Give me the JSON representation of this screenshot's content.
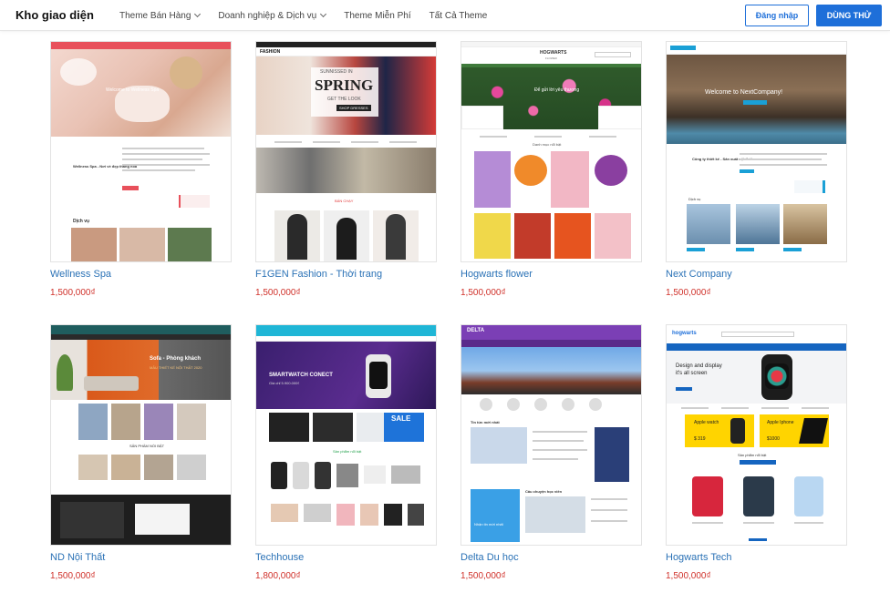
{
  "header": {
    "logo": "Kho giao diện",
    "nav": [
      {
        "label": "Theme Bán Hàng",
        "has_dropdown": true
      },
      {
        "label": "Doanh nghiệp & Dịch vụ",
        "has_dropdown": true
      },
      {
        "label": "Theme Miễn Phí",
        "has_dropdown": false
      },
      {
        "label": "Tất Cả Theme",
        "has_dropdown": false
      }
    ],
    "login_label": "Đăng nhập",
    "try_label": "DÙNG THỬ"
  },
  "themes": [
    {
      "name": "Wellness Spa",
      "price": "1,500,000₫",
      "hero_text": "Welcome to Wellness Spa",
      "section_title": "Wellness Spa - Nơi về đẹp thăng hoa",
      "block_label": "Dịch vụ"
    },
    {
      "name": "F1GEN Fashion - Thời trang",
      "price": "1,500,000₫",
      "hero_line1": "SUNNISSED IN",
      "hero_line2": "SPRING",
      "hero_line3": "GET THE LOOK",
      "hero_btn": "SHOP DRESSES",
      "brand": "FASHION",
      "block_label": "BÁN CHẠY"
    },
    {
      "name": "Hogwarts flower",
      "price": "1,500,000₫",
      "brand": "HOGWARTS",
      "brand_sub": "FLOWER",
      "hero_text": "Để gửi lời yêu thương",
      "block_label": "Danh mục nổi bật"
    },
    {
      "name": "Next Company",
      "price": "1,500,000₫",
      "hero_text": "Welcome to NextCompany!",
      "section_title": "Công ty thiết kế - Sản xuất nội thất",
      "block_label": "Dịch vụ"
    },
    {
      "name": "ND Nội Thất",
      "price": "1,500,000₫",
      "hero_line1": "Sofa - Phòng khách",
      "hero_line2": "MẪU THIẾT KẾ NỘI THẤT 2020",
      "block_label": "SẢN PHẨM NỔI BẬT"
    },
    {
      "name": "Techhouse",
      "price": "1,800,000₫",
      "hero_line1": "SMARTWATCH CONECT",
      "hero_line2": "Giá chỉ 5.900.000₫",
      "sale_text": "SALE",
      "block_label": "Sản phẩm nổi bật"
    },
    {
      "name": "Delta Du học",
      "price": "1,500,000₫",
      "brand": "DELTA",
      "block_label1": "Tin tức mới nhất",
      "block_label2": "Câu chuyện học viên",
      "promo_text": "Nhận tin mới nhất"
    },
    {
      "name": "Hogwarts Tech",
      "price": "1,500,000₫",
      "brand": "hogwarts",
      "hero_line1": "Design and display",
      "hero_line2": "it's all screen",
      "promo1": "Apple watch",
      "promo1_price": "$ 319",
      "promo2": "Apple Iphone",
      "promo2_price": "$1000",
      "block_label": "Sản phẩm nổi bật"
    }
  ],
  "colors": {
    "accent": "#1e6fd9",
    "title_link": "#2b72b6",
    "price": "#d0322b"
  }
}
